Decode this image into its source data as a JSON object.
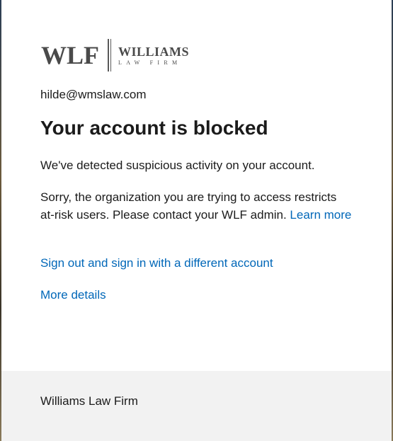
{
  "logo": {
    "mark": "WLF",
    "name": "WILLIAMS",
    "sub": "LAW FIRM"
  },
  "account": {
    "email": "hilde@wmslaw.com"
  },
  "page": {
    "title": "Your account is blocked",
    "message1": "We've detected suspicious activity on your account.",
    "message2": "Sorry, the organization you are trying to access restricts at-risk users. Please contact your WLF admin.",
    "learn_more": "Learn more",
    "sign_out_link": "Sign out and sign in with a different account",
    "more_details_link": "More details"
  },
  "footer": {
    "org_name": "Williams Law Firm"
  },
  "colors": {
    "link": "#0067b8",
    "text": "#1b1b1b",
    "footer_bg": "#f2f2f2"
  }
}
